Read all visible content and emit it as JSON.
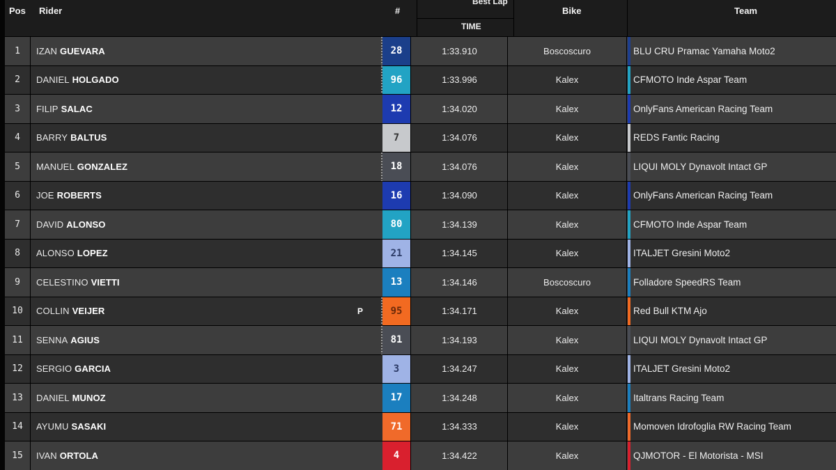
{
  "header": {
    "pos": "Pos",
    "rider": "Rider",
    "num": "#",
    "best_lap": "Best Lap",
    "time": "TIME",
    "bike": "Bike",
    "team": "Team"
  },
  "rows": [
    {
      "pos": "1",
      "first": "IZAN",
      "last": "GUEVARA",
      "marker": "",
      "num": "28",
      "num_bg": "#1b3f8a",
      "num_fg": "#ffffff",
      "dots": true,
      "time": "1:33.910",
      "bike": "Boscoscuro",
      "team": "BLU CRU Pramac Yamaha Moto2",
      "team_color": "#1e3f8f"
    },
    {
      "pos": "2",
      "first": "DANIEL",
      "last": "HOLGADO",
      "marker": "",
      "num": "96",
      "num_bg": "#22a3c4",
      "num_fg": "#ffffff",
      "dots": true,
      "time": "1:33.996",
      "bike": "Kalex",
      "team": "CFMOTO Inde Aspar Team",
      "team_color": "#22a3c4"
    },
    {
      "pos": "3",
      "first": "FILIP",
      "last": "SALAC",
      "marker": "",
      "num": "12",
      "num_bg": "#1d3bb0",
      "num_fg": "#ffffff",
      "dots": false,
      "time": "1:34.020",
      "bike": "Kalex",
      "team": "OnlyFans American Racing Team",
      "team_color": "#1d3bb0"
    },
    {
      "pos": "4",
      "first": "BARRY",
      "last": "BALTUS",
      "marker": "",
      "num": "7",
      "num_bg": "#c7c9cc",
      "num_fg": "#333333",
      "dots": false,
      "time": "1:34.076",
      "bike": "Kalex",
      "team": "REDS Fantic Racing",
      "team_color": "#c7c9cc"
    },
    {
      "pos": "5",
      "first": "MANUEL",
      "last": "GONZALEZ",
      "marker": "",
      "num": "18",
      "num_bg": "#4a4d55",
      "num_fg": "#ffffff",
      "dots": true,
      "time": "1:34.076",
      "bike": "Kalex",
      "team": "LIQUI MOLY Dynavolt Intact GP",
      "team_color": "#4a4d55"
    },
    {
      "pos": "6",
      "first": "JOE",
      "last": "ROBERTS",
      "marker": "",
      "num": "16",
      "num_bg": "#1d3bb0",
      "num_fg": "#ffffff",
      "dots": false,
      "time": "1:34.090",
      "bike": "Kalex",
      "team": "OnlyFans American Racing Team",
      "team_color": "#1d3bb0"
    },
    {
      "pos": "7",
      "first": "DAVID",
      "last": "ALONSO",
      "marker": "",
      "num": "80",
      "num_bg": "#22a3c4",
      "num_fg": "#ffffff",
      "dots": false,
      "time": "1:34.139",
      "bike": "Kalex",
      "team": "CFMOTO Inde Aspar Team",
      "team_color": "#22a3c4"
    },
    {
      "pos": "8",
      "first": "ALONSO",
      "last": "LOPEZ",
      "marker": "",
      "num": "21",
      "num_bg": "#9fb3e6",
      "num_fg": "#2b3a66",
      "dots": false,
      "time": "1:34.145",
      "bike": "Kalex",
      "team": "ITALJET Gresini Moto2",
      "team_color": "#9fb3e6"
    },
    {
      "pos": "9",
      "first": "CELESTINO",
      "last": "VIETTI",
      "marker": "",
      "num": "13",
      "num_bg": "#1b7fbf",
      "num_fg": "#ffffff",
      "dots": false,
      "time": "1:34.146",
      "bike": "Boscoscuro",
      "team": "Folladore SpeedRS Team",
      "team_color": "#1b7fbf"
    },
    {
      "pos": "10",
      "first": "COLLIN",
      "last": "VEIJER",
      "marker": "P",
      "num": "95",
      "num_bg": "#f26a21",
      "num_fg": "#6b2a0a",
      "dots": true,
      "time": "1:34.171",
      "bike": "Kalex",
      "team": "Red Bull KTM Ajo",
      "team_color": "#f26a21"
    },
    {
      "pos": "11",
      "first": "SENNA",
      "last": "AGIUS",
      "marker": "",
      "num": "81",
      "num_bg": "#4a4d55",
      "num_fg": "#ffffff",
      "dots": true,
      "time": "1:34.193",
      "bike": "Kalex",
      "team": "LIQUI MOLY Dynavolt Intact GP",
      "team_color": "#4a4d55"
    },
    {
      "pos": "12",
      "first": "SERGIO",
      "last": "GARCIA",
      "marker": "",
      "num": "3",
      "num_bg": "#9fb3e6",
      "num_fg": "#2b3a66",
      "dots": false,
      "time": "1:34.247",
      "bike": "Kalex",
      "team": "ITALJET Gresini Moto2",
      "team_color": "#9fb3e6"
    },
    {
      "pos": "13",
      "first": "DANIEL",
      "last": "MUNOZ",
      "marker": "",
      "num": "17",
      "num_bg": "#1b7fbf",
      "num_fg": "#ffffff",
      "dots": false,
      "time": "1:34.248",
      "bike": "Kalex",
      "team": "Italtrans Racing Team",
      "team_color": "#1b7fbf"
    },
    {
      "pos": "14",
      "first": "AYUMU",
      "last": "SASAKI",
      "marker": "",
      "num": "71",
      "num_bg": "#f06a2a",
      "num_fg": "#ffffff",
      "dots": false,
      "time": "1:34.333",
      "bike": "Kalex",
      "team": "Momoven Idrofoglia RW Racing Team",
      "team_color": "#f06a2a"
    },
    {
      "pos": "15",
      "first": "IVAN",
      "last": "ORTOLA",
      "marker": "",
      "num": "4",
      "num_bg": "#d9202e",
      "num_fg": "#ffffff",
      "dots": false,
      "time": "1:34.422",
      "bike": "Kalex",
      "team": "QJMOTOR - El Motorista - MSI",
      "team_color": "#d9202e"
    }
  ]
}
